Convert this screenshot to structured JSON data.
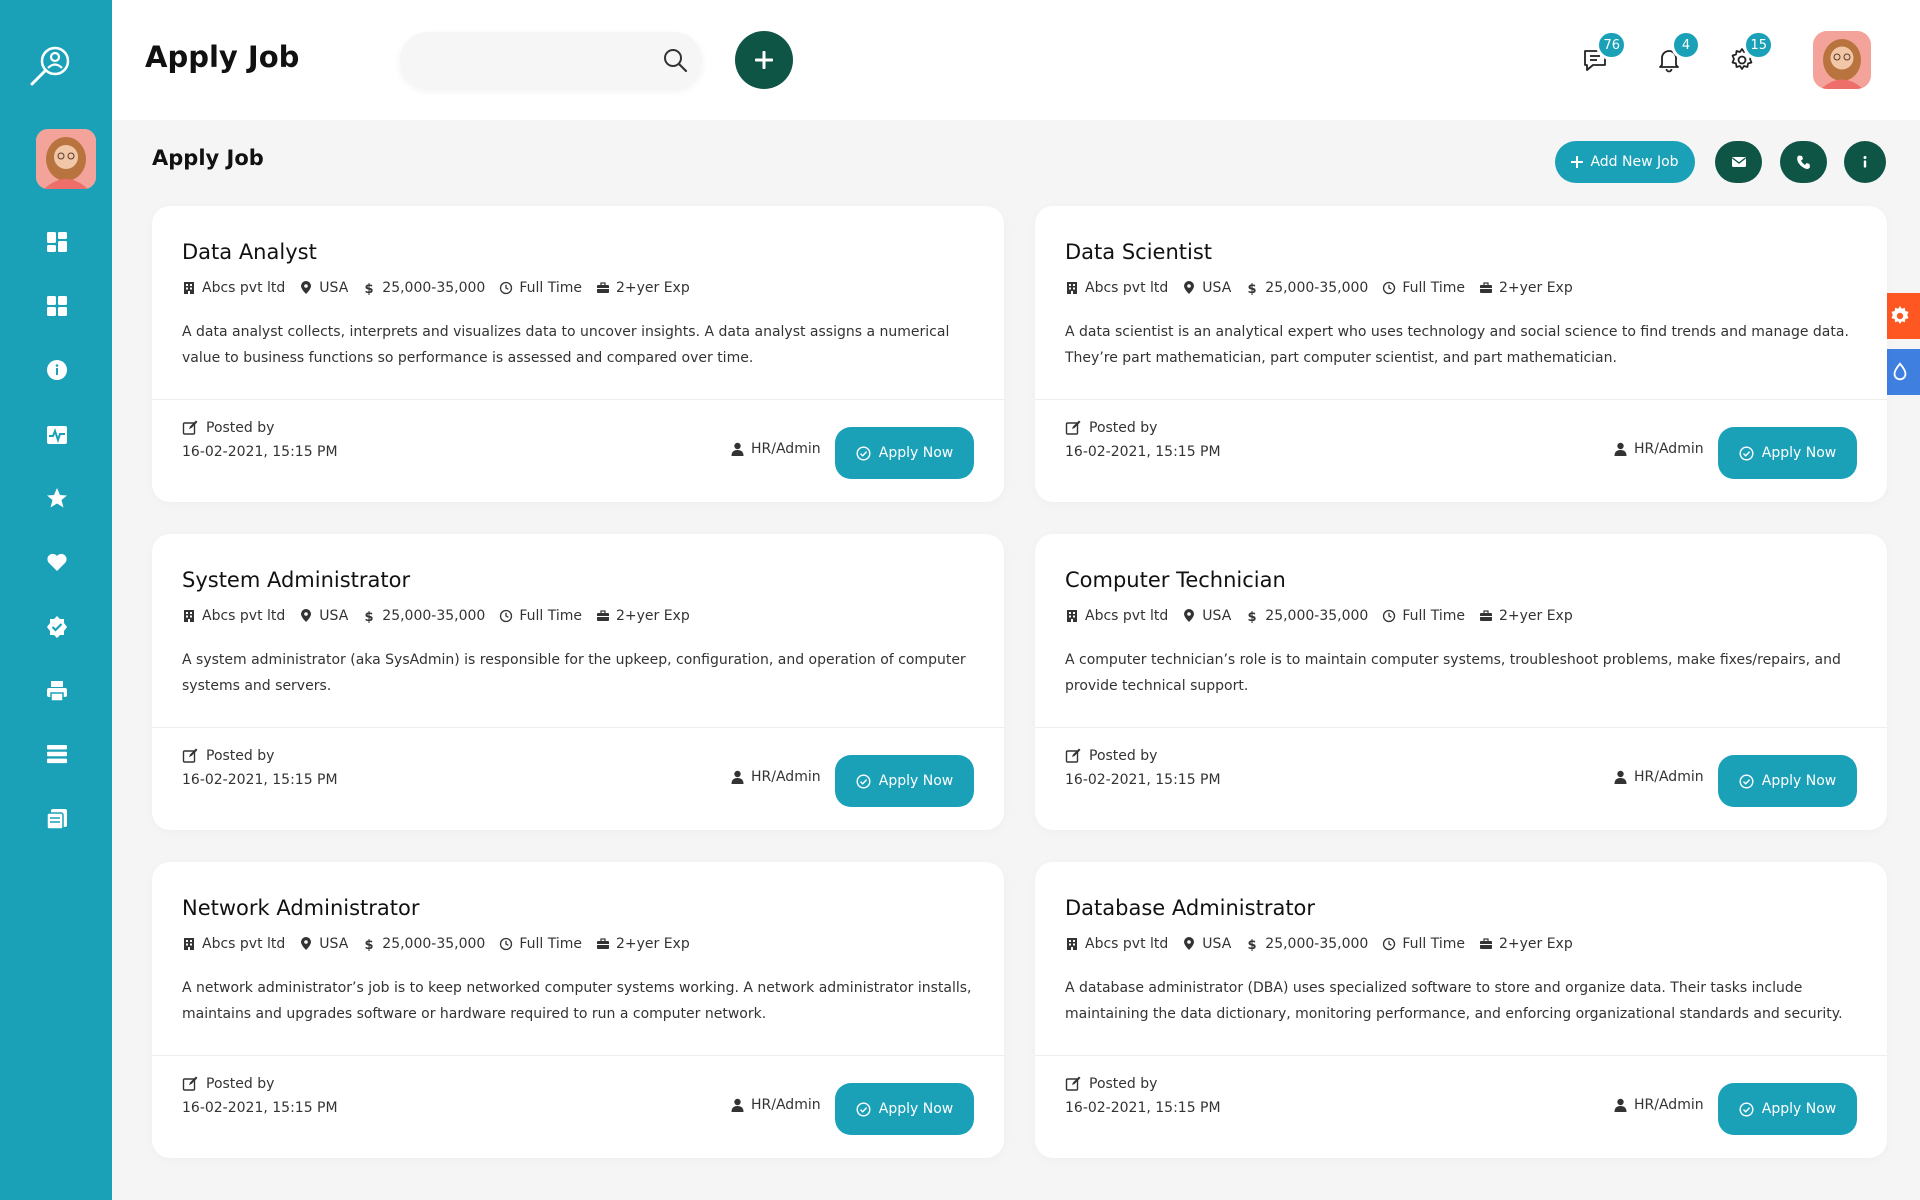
{
  "header": {
    "title": "Apply Job",
    "search_placeholder": "",
    "messages_count": "76",
    "notifications_count": "4",
    "settings_count": "15"
  },
  "sidebar": {
    "items": [
      {
        "icon": "dashboard-icon"
      },
      {
        "icon": "apps-icon"
      },
      {
        "icon": "info-icon"
      },
      {
        "icon": "activity-icon"
      },
      {
        "icon": "star-icon"
      },
      {
        "icon": "heart-icon"
      },
      {
        "icon": "verified-badge-icon"
      },
      {
        "icon": "printer-icon"
      },
      {
        "icon": "list-icon"
      },
      {
        "icon": "documents-icon"
      }
    ]
  },
  "toolbar": {
    "subtitle": "Apply Job",
    "add_job_label": "Add New Job"
  },
  "jobs": [
    {
      "title": "Data Analyst",
      "company": "Abcs pvt ltd",
      "location": "USA",
      "salary": "25,000-35,000",
      "type": "Full Time",
      "experience": "2+yer Exp",
      "description": "A data analyst collects, interprets and visualizes data to uncover insights. A data analyst assigns a numerical value to business functions so performance is assessed and compared over time.",
      "posted_label": "Posted by",
      "posted_date": "16-02-2021, 15:15 PM",
      "author": "HR/Admin",
      "apply_label": "Apply Now"
    },
    {
      "title": "Data Scientist",
      "company": "Abcs pvt ltd",
      "location": "USA",
      "salary": "25,000-35,000",
      "type": "Full Time",
      "experience": "2+yer Exp",
      "description": "A data scientist is an analytical expert who uses technology and social science to find trends and manage data. They’re part mathematician, part computer scientist, and part mathematician.",
      "posted_label": "Posted by",
      "posted_date": "16-02-2021, 15:15 PM",
      "author": "HR/Admin",
      "apply_label": "Apply Now"
    },
    {
      "title": "System Administrator",
      "company": "Abcs pvt ltd",
      "location": "USA",
      "salary": "25,000-35,000",
      "type": "Full Time",
      "experience": "2+yer Exp",
      "description": "A system administrator (aka SysAdmin) is responsible for the upkeep, configuration, and operation of computer systems and servers.",
      "posted_label": "Posted by",
      "posted_date": "16-02-2021, 15:15 PM",
      "author": "HR/Admin",
      "apply_label": "Apply Now"
    },
    {
      "title": "Computer Technician",
      "company": "Abcs pvt ltd",
      "location": "USA",
      "salary": "25,000-35,000",
      "type": "Full Time",
      "experience": "2+yer Exp",
      "description": "A computer technician’s role is to maintain computer systems, troubleshoot problems, make fixes/repairs, and provide technical support.",
      "posted_label": "Posted by",
      "posted_date": "16-02-2021, 15:15 PM",
      "author": "HR/Admin",
      "apply_label": "Apply Now"
    },
    {
      "title": "Network Administrator",
      "company": "Abcs pvt ltd",
      "location": "USA",
      "salary": "25,000-35,000",
      "type": "Full Time",
      "experience": "2+yer Exp",
      "description": "A network administrator’s job is to keep networked computer systems working. A network administrator installs, maintains and upgrades software or hardware required to run a computer network.",
      "posted_label": "Posted by",
      "posted_date": "16-02-2021, 15:15 PM",
      "author": "HR/Admin",
      "apply_label": "Apply Now"
    },
    {
      "title": "Database Administrator",
      "company": "Abcs pvt ltd",
      "location": "USA",
      "salary": "25,000-35,000",
      "type": "Full Time",
      "experience": "2+yer Exp",
      "description": "A database administrator (DBA) uses specialized software to store and organize data. Their tasks include maintaining the data dictionary, monitoring performance, and enforcing organizational standards and security.",
      "posted_label": "Posted by",
      "posted_date": "16-02-2021, 15:15 PM",
      "author": "HR/Admin",
      "apply_label": "Apply Now"
    }
  ],
  "colors": {
    "sidebar": "#1aa1b8",
    "accent": "#1aa1b8",
    "dark_green": "#0e5546",
    "orange": "#ff5722",
    "blue": "#3f7fe0"
  }
}
